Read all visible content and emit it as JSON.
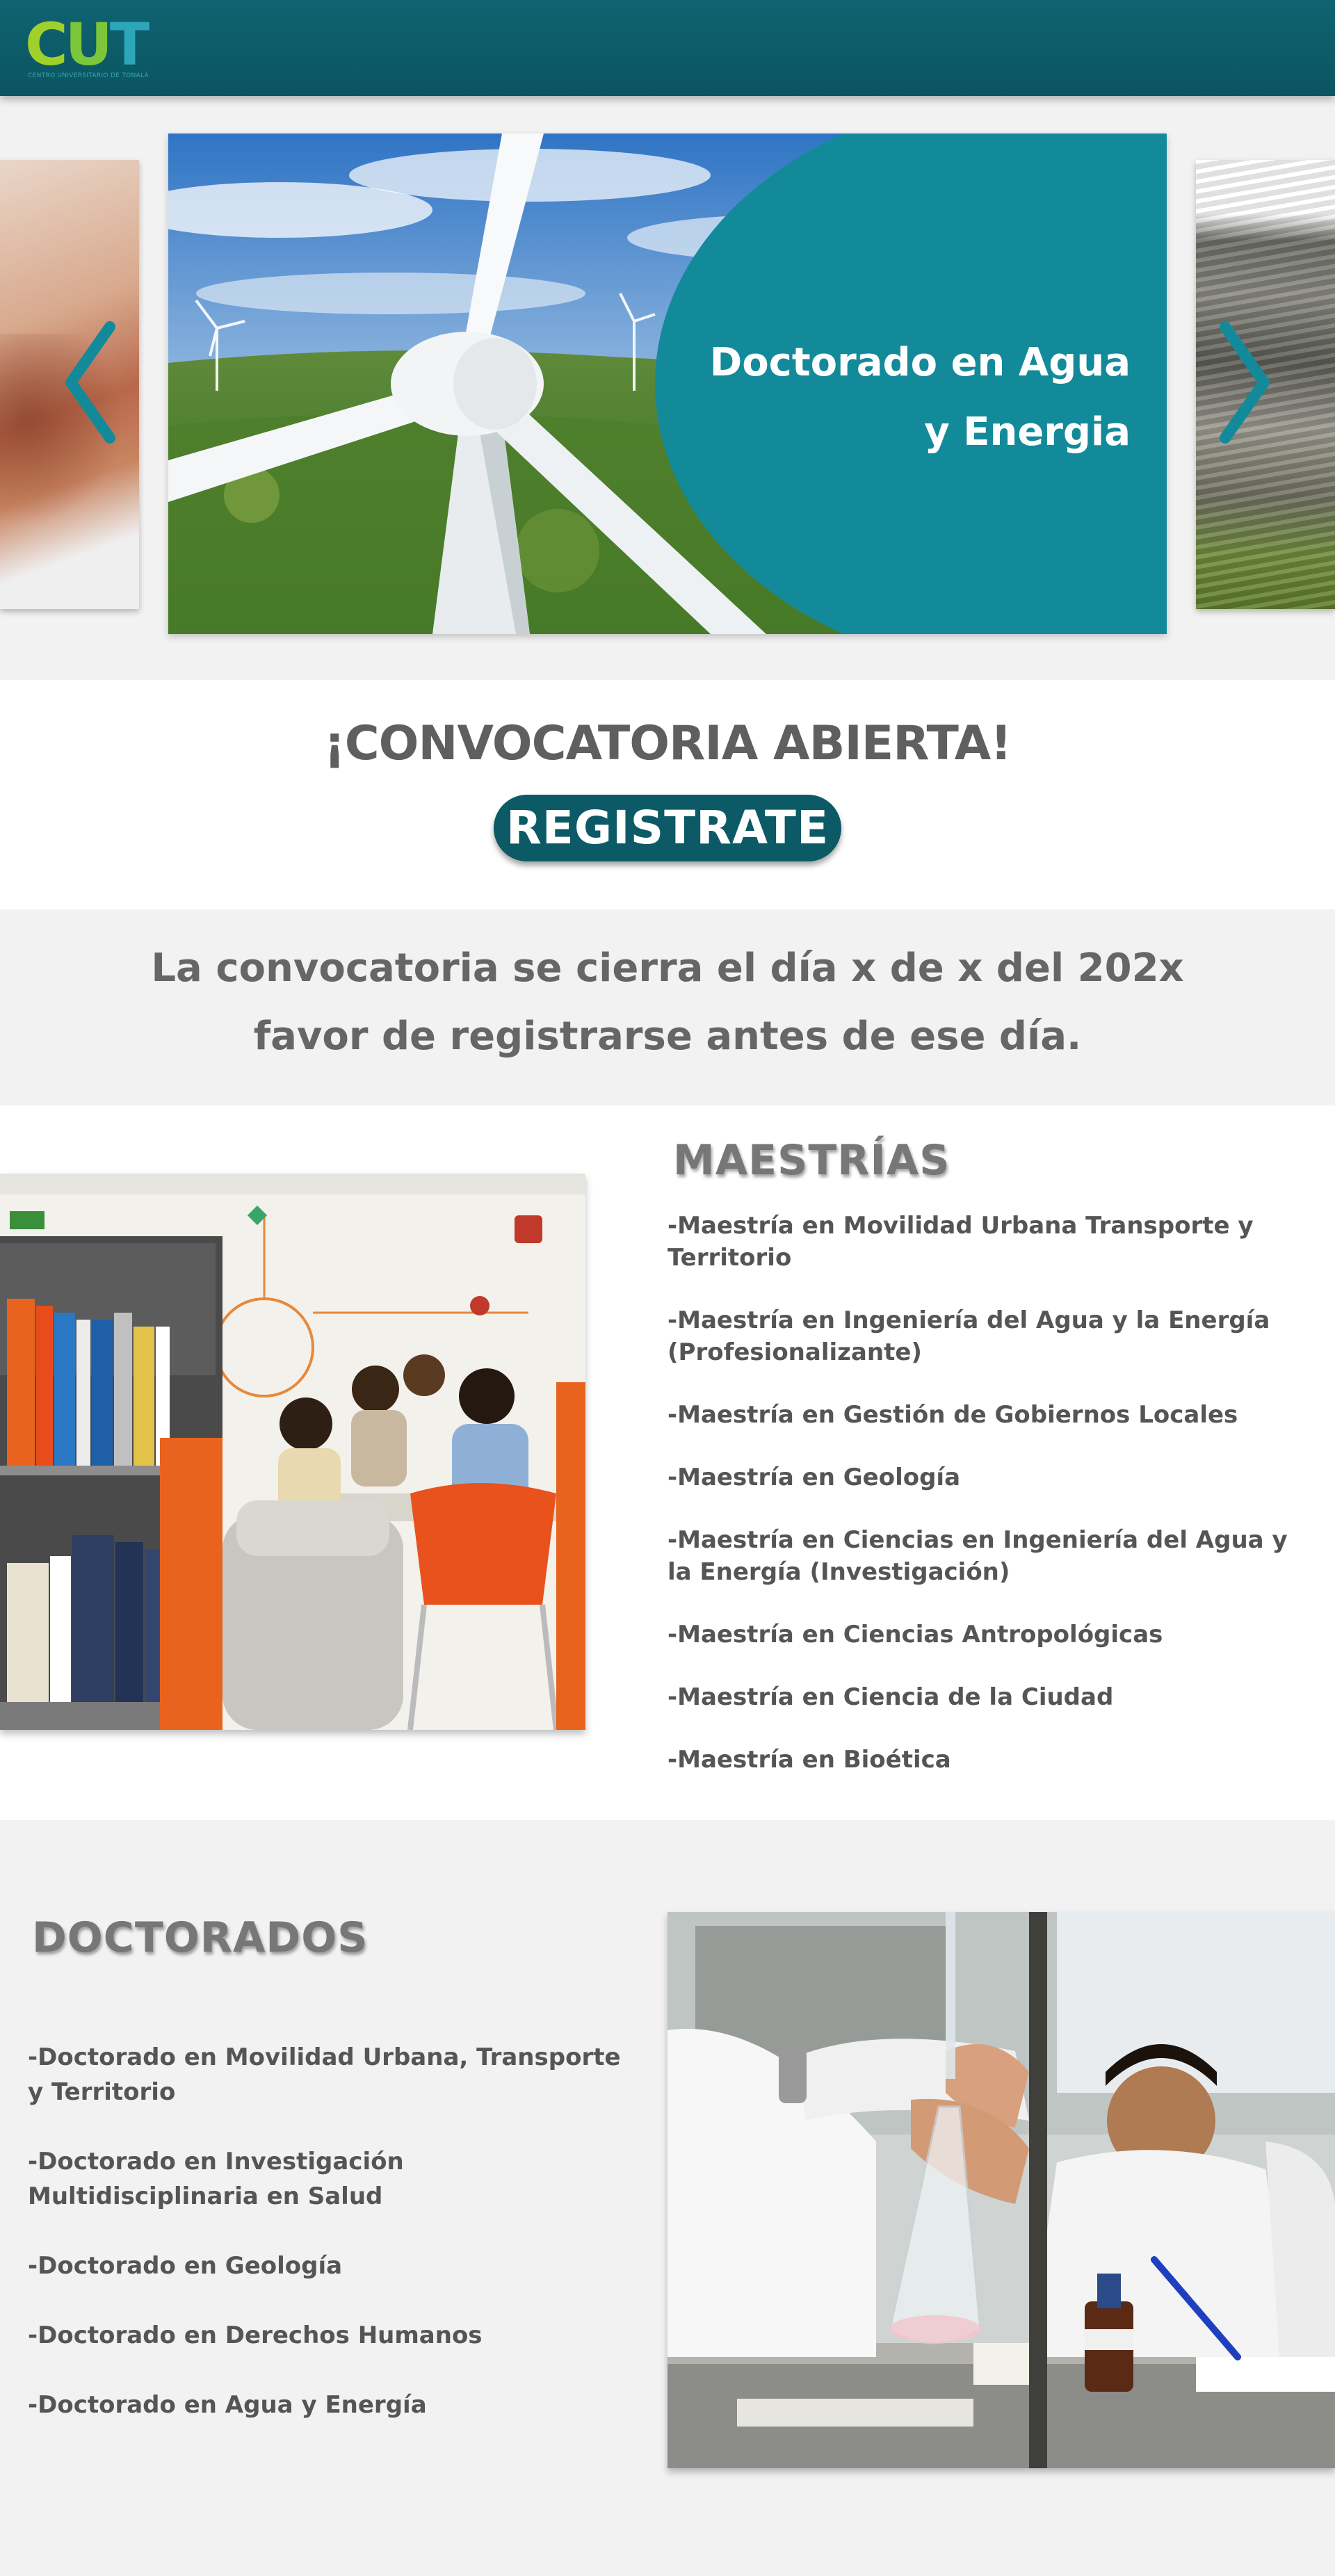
{
  "header": {
    "logo_text_c": "C",
    "logo_text_u": "U",
    "logo_text_t": "T",
    "logo_tagline": "CENTRO UNIVERSITARIO DE TONALÁ"
  },
  "carousel": {
    "slide_title": "Doctorado en Agua y Energia",
    "prev_icon": "chevron-left-icon",
    "next_icon": "chevron-right-icon"
  },
  "cta": {
    "title": "¡CONVOCATORIA ABIERTA!",
    "button_label": "REGISTRATE"
  },
  "deadline": {
    "line1": "La convocatoria se cierra el día x de x del 202x",
    "line2": "favor de registrarse antes de ese día."
  },
  "masters": {
    "title": "MAESTRÍAS",
    "items": [
      "-Maestría en Movilidad Urbana Transporte y Territorio",
      "-Maestría en Ingeniería del Agua y la Energía (Profesionalizante)",
      "-Maestría en Gestión de Gobiernos Locales",
      "-Maestría en Geología",
      "-Maestría en Ciencias en Ingeniería del Agua y la Energía (Investigación)",
      "-Maestría en Ciencias Antropológicas",
      "-Maestría en Ciencia de la Ciudad",
      "-Maestría en Bioética"
    ]
  },
  "doctors": {
    "title": "DOCTORADOS",
    "items": [
      "-Doctorado en Movilidad Urbana, Transporte y Territorio",
      "-Doctorado en Investigación Multidisciplinaria en Salud",
      "-Doctorado en Geología",
      "-Doctorado en Derechos Humanos",
      "-Doctorado en Agua y Energía"
    ]
  },
  "colors": {
    "header_teal": "#0b5561",
    "accent_teal": "#138a9a",
    "button_teal": "#0b5a66"
  }
}
